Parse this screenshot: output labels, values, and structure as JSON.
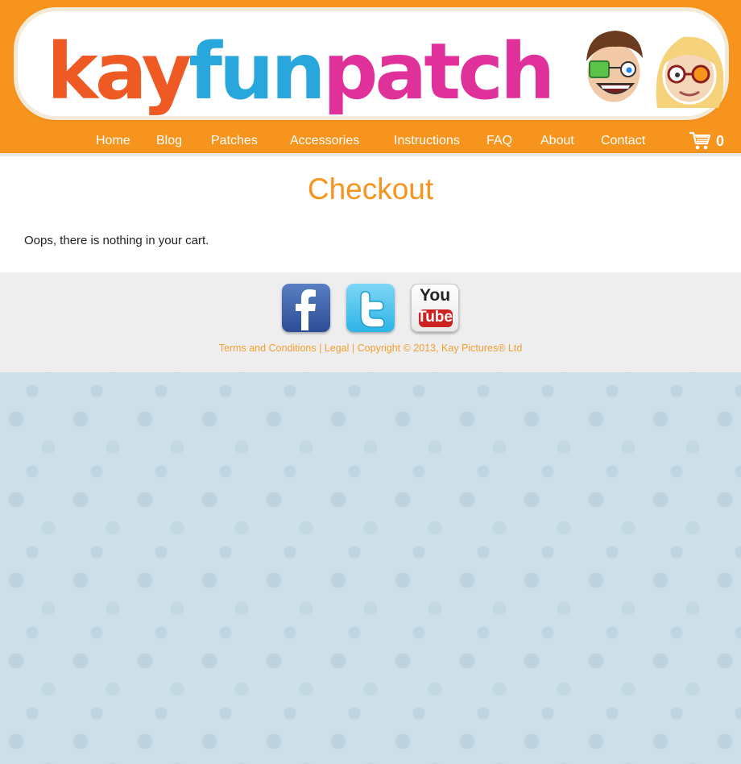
{
  "brand": {
    "logo_parts": [
      "kay",
      "fun",
      "patch"
    ],
    "colors": {
      "kay": "#ef5a24",
      "fun": "#29a6dc",
      "patch": "#e0319a",
      "header": "#f7941d"
    }
  },
  "nav": {
    "items": [
      {
        "label": "Home"
      },
      {
        "label": "Blog"
      },
      {
        "label": "Patches"
      },
      {
        "label": "Accessories"
      },
      {
        "label": "Instructions"
      },
      {
        "label": "FAQ"
      },
      {
        "label": "About"
      },
      {
        "label": "Contact"
      }
    ],
    "cart_icon": "shopping-cart-icon",
    "cart_count": "0"
  },
  "main": {
    "title": "Checkout",
    "message": "Oops, there is nothing in your cart."
  },
  "footer": {
    "social": [
      {
        "name": "facebook-icon"
      },
      {
        "name": "twitter-icon"
      },
      {
        "name": "youtube-icon",
        "label_top": "You",
        "label_bottom": "Tube"
      }
    ],
    "terms": "Terms and Conditions",
    "legal": "Legal",
    "copyright": "Copyright © 2013, Kay Pictures® Ltd",
    "separator": "|"
  }
}
